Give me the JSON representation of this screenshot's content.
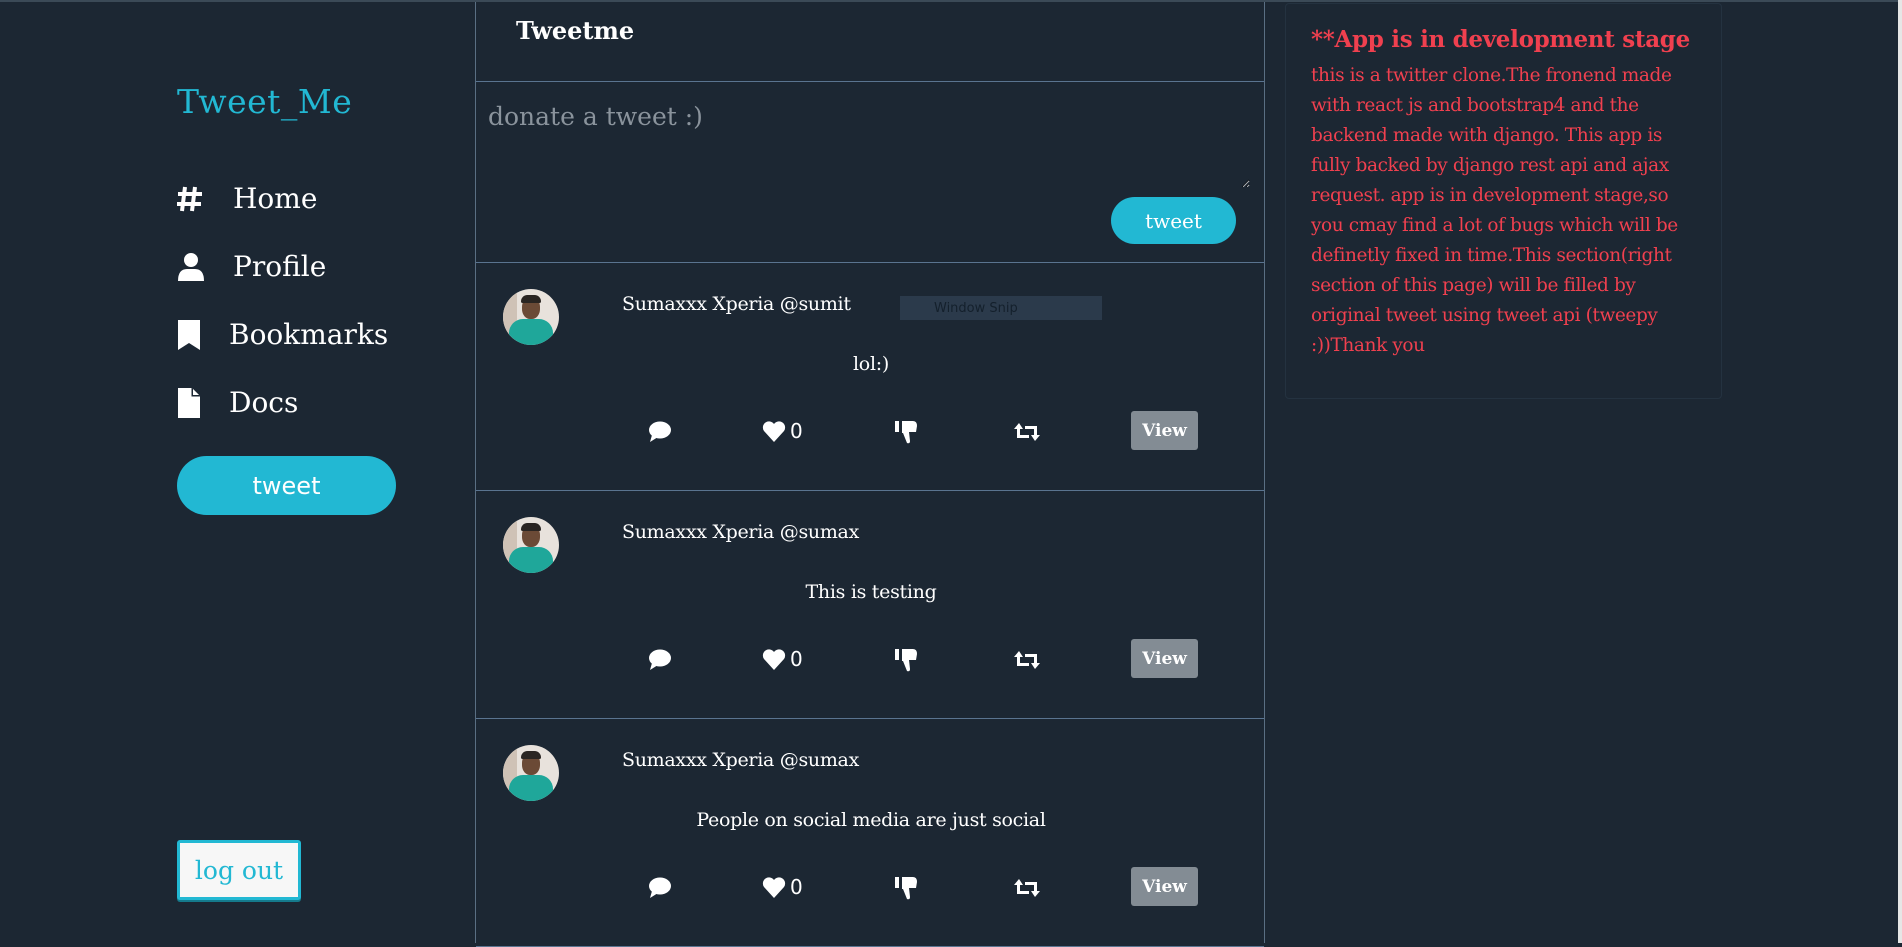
{
  "sidebar": {
    "logo": "Tweet_Me",
    "nav": [
      {
        "label": "Home",
        "icon": "hashtag-icon"
      },
      {
        "label": "Profile",
        "icon": "user-icon"
      },
      {
        "label": "Bookmarks",
        "icon": "bookmark-icon"
      },
      {
        "label": "Docs",
        "icon": "file-icon"
      }
    ],
    "tweet_button": "tweet",
    "logout_button": "log out"
  },
  "center": {
    "title": "Tweetme",
    "compose": {
      "placeholder": "donate a tweet :)",
      "value": "",
      "submit_label": "tweet"
    },
    "tweets": [
      {
        "author": "Sumaxxx Xperia @sumit",
        "content": "lol:)",
        "likes": "0",
        "view_label": "View"
      },
      {
        "author": "Sumaxxx Xperia @sumax",
        "content": "This is testing",
        "likes": "0",
        "view_label": "View"
      },
      {
        "author": "Sumaxxx Xperia @sumax",
        "content": "People on social media are just social",
        "likes": "0",
        "view_label": "View"
      }
    ],
    "overlay_tooltip": "Window Snip"
  },
  "right_panel": {
    "title": "**App is in development stage",
    "body": "this is a twitter clone.The fronend made with react js and bootstrap4 and the backend made with django. This app is fully backed by django rest api and ajax request. app is in development stage,so you cmay find a lot of bugs which will be definetly fixed in time.This section(right section of this page) will be filled by original tweet using tweet api (tweepy :))Thank you"
  },
  "colors": {
    "background": "#1c2733",
    "accent": "#22b8d3",
    "notice": "#f0404f",
    "divider": "#5a7490",
    "view_button": "#838c94"
  }
}
